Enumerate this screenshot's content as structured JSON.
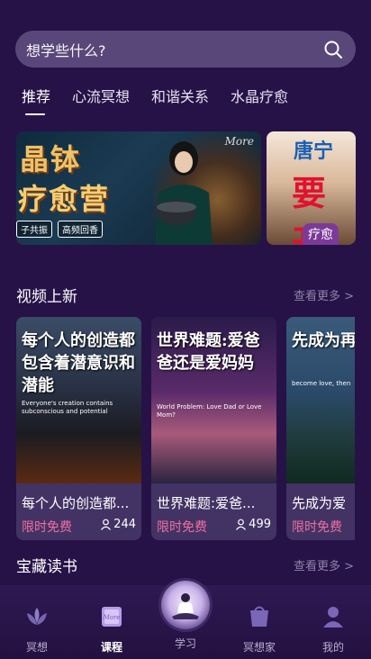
{
  "search": {
    "placeholder": "想学些什么?"
  },
  "tabs": [
    "推荐",
    "心流冥想",
    "和谐关系",
    "水晶疗愈"
  ],
  "banner": {
    "title_line1": "晶钵",
    "title_line2": "疗愈营",
    "tags": [
      "子共振",
      "高频回香"
    ],
    "more": "More",
    "second_title": "唐宁",
    "second_big": "要开",
    "second_tag": "疗愈"
  },
  "sections": {
    "new_videos": {
      "title": "视频上新",
      "more": "查看更多 >"
    },
    "books": {
      "title": "宝藏读书",
      "more": "查看更多 >"
    }
  },
  "cards": [
    {
      "caption": "每个人的创造都包含着潜意识和潜能",
      "sub": "Everyone's creation contains subconscious and potential",
      "name": "每个人的创造都...",
      "price": "限时免费",
      "count": "244"
    },
    {
      "caption": "世界难题:爱爸爸还是爱妈妈",
      "sub": "World Problem: Love Dad or Love Mom?",
      "name": "世界难题:爱爸...",
      "price": "限时免费",
      "count": "499"
    },
    {
      "caption": "先成为再给",
      "sub": "become love, then",
      "name": "先成为爱",
      "price": "限时免费",
      "count": ""
    }
  ],
  "tabbar": [
    {
      "label": "冥想",
      "icon": "lotus-icon"
    },
    {
      "label": "课程",
      "icon": "course-book-icon"
    },
    {
      "label": "学习",
      "icon": "meditating-person-icon"
    },
    {
      "label": "冥想家",
      "icon": "bag-icon"
    },
    {
      "label": "我的",
      "icon": "user-icon"
    }
  ]
}
